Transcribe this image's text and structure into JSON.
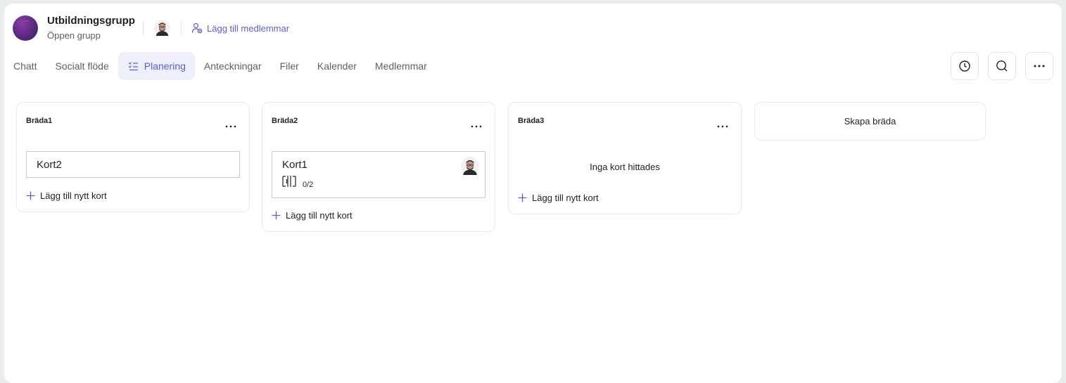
{
  "group": {
    "title": "Utbildningsgrupp",
    "subtitle": "Öppen grupp",
    "add_members_label": "Lägg till medlemmar"
  },
  "tabs": [
    {
      "label": "Chatt",
      "active": false
    },
    {
      "label": "Socialt flöde",
      "active": false
    },
    {
      "label": "Planering",
      "active": true
    },
    {
      "label": "Anteckningar",
      "active": false
    },
    {
      "label": "Filer",
      "active": false
    },
    {
      "label": "Kalender",
      "active": false
    },
    {
      "label": "Medlemmar",
      "active": false
    }
  ],
  "toolbar_icons": [
    "clock-icon",
    "search-icon",
    "more-icon"
  ],
  "boards": [
    {
      "title": "Bräda1",
      "cards": [
        {
          "title": "Kort2"
        }
      ],
      "add_card_label": "Lägg till nytt kort"
    },
    {
      "title": "Bräda2",
      "cards": [
        {
          "title": "Kort1",
          "checklist": "0/2",
          "assignee_avatar": true
        }
      ],
      "add_card_label": "Lägg till nytt kort"
    },
    {
      "title": "Bräda3",
      "cards": [],
      "empty_label": "Inga kort hittades",
      "add_card_label": "Lägg till nytt kort"
    }
  ],
  "create_board_label": "Skapa bräda",
  "colors": {
    "accent": "#5b5fc7",
    "active_tab_bg": "#eeeffb",
    "page_bg": "#e9ecec",
    "card_border": "#c8cacd"
  }
}
